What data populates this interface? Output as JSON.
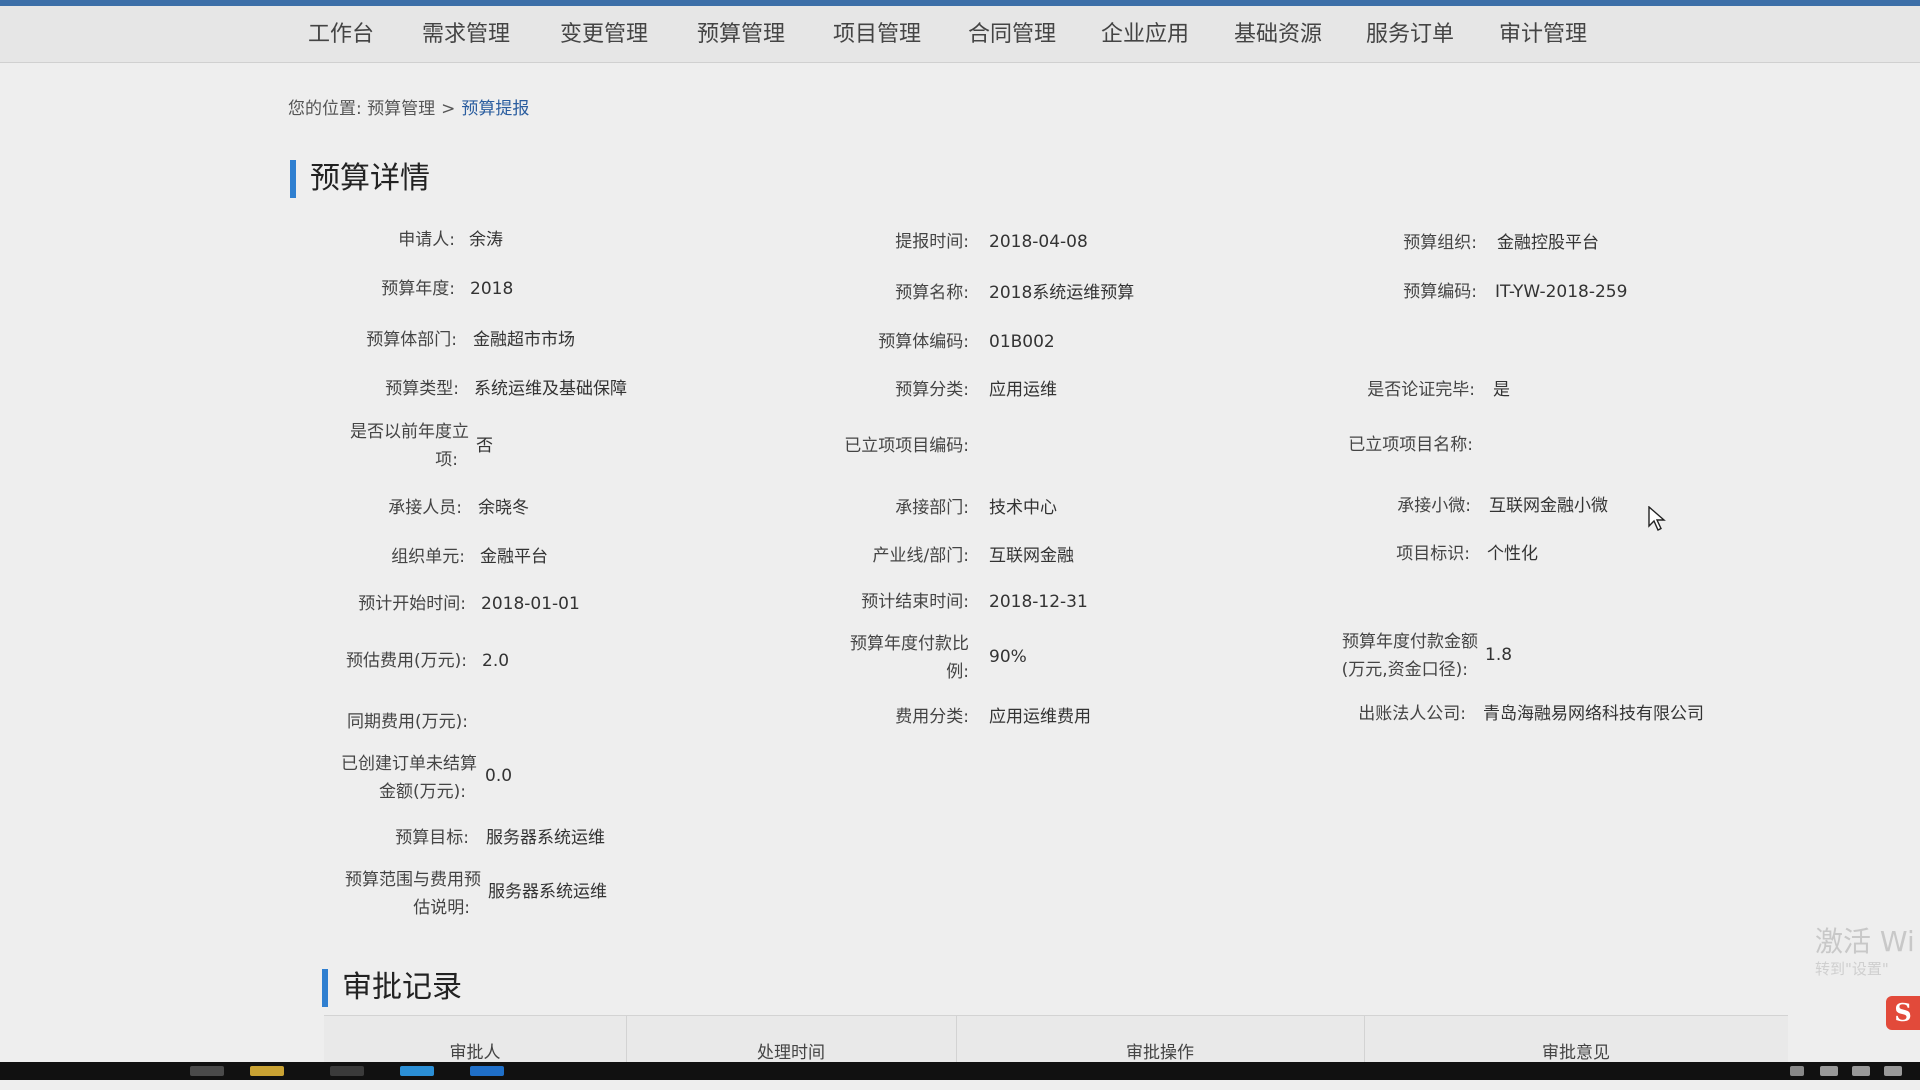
{
  "nav": {
    "items": [
      "工作台",
      "需求管理",
      "变更管理",
      "预算管理",
      "项目管理",
      "合同管理",
      "企业应用",
      "基础资源",
      "服务订单",
      "审计管理"
    ]
  },
  "breadcrumb": {
    "prefix": "您的位置:",
    "parent": "预算管理",
    "separator": ">",
    "current": "预算提报"
  },
  "detail": {
    "title": "预算详情",
    "fields": {
      "applicant": {
        "label": "申请人:",
        "value": "余涛"
      },
      "submit_time": {
        "label": "提报时间:",
        "value": "2018-04-08"
      },
      "budget_org": {
        "label": "预算组织:",
        "value": "金融控股平台"
      },
      "budget_year": {
        "label": "预算年度:",
        "value": "2018"
      },
      "budget_name": {
        "label": "预算名称:",
        "value": "2018系统运维预算"
      },
      "budget_code": {
        "label": "预算编码:",
        "value": "IT-YW-2018-259"
      },
      "budget_dept": {
        "label": "预算体部门:",
        "value": "金融超市市场"
      },
      "budget_dept_code": {
        "label": "预算体编码:",
        "value": "01B002"
      },
      "budget_type": {
        "label": "预算类型:",
        "value": "系统运维及基础保障"
      },
      "budget_category": {
        "label": "预算分类:",
        "value": "应用运维"
      },
      "argued_done": {
        "label": "是否论证完毕:",
        "value": "是"
      },
      "prev_year_project": {
        "label_line1": "是否以前年度立",
        "label_line2": "项:",
        "value": "否"
      },
      "project_code": {
        "label": "已立项项目编码:",
        "value": ""
      },
      "project_name": {
        "label": "已立项项目名称:",
        "value": ""
      },
      "undertaker": {
        "label": "承接人员:",
        "value": "余晓冬"
      },
      "undertake_dept": {
        "label": "承接部门:",
        "value": "技术中心"
      },
      "undertake_team": {
        "label": "承接小微:",
        "value": "互联网金融小微"
      },
      "org_unit": {
        "label": "组织单元:",
        "value": "金融平台"
      },
      "industry_line": {
        "label": "产业线/部门:",
        "value": "互联网金融"
      },
      "project_tag": {
        "label": "项目标识:",
        "value": "个性化"
      },
      "planned_start": {
        "label": "预计开始时间:",
        "value": "2018-01-01"
      },
      "planned_end": {
        "label": "预计结束时间:",
        "value": "2018-12-31"
      },
      "estimated_cost": {
        "label": "预估费用(万元):",
        "value": "2.0"
      },
      "payment_ratio": {
        "label_line1": "预算年度付款比",
        "label_line2": "例:",
        "value": "90%"
      },
      "payment_amount": {
        "label_line1": "预算年度付款金额",
        "label_line2": "(万元,资金口径):",
        "value": "1.8"
      },
      "same_period_cost": {
        "label": "同期费用(万元):",
        "value": ""
      },
      "cost_category": {
        "label": "费用分类:",
        "value": "应用运维费用"
      },
      "billing_company": {
        "label": "出账法人公司:",
        "value": "青岛海融易网络科技有限公司"
      },
      "unsettled_amount": {
        "label_line1": "已创建订单未结算",
        "label_line2": "金额(万元):",
        "value": "0.0"
      },
      "budget_goal": {
        "label": "预算目标:",
        "value": "服务器系统运维"
      },
      "budget_scope": {
        "label_line1": "预算范围与费用预",
        "label_line2": "估说明:",
        "value": "服务器系统运维"
      }
    }
  },
  "approval": {
    "title": "审批记录",
    "columns": [
      "审批人",
      "处理时间",
      "审批操作",
      "审批意见"
    ]
  },
  "overlay": {
    "watermark": "激活 Wi",
    "watermark_sub": "转到\"设置\"",
    "sogou_badge": "S"
  },
  "colors": {
    "accent": "#2f7fd0",
    "link": "#2a5d9f",
    "page_bg": "#eeeeee"
  }
}
